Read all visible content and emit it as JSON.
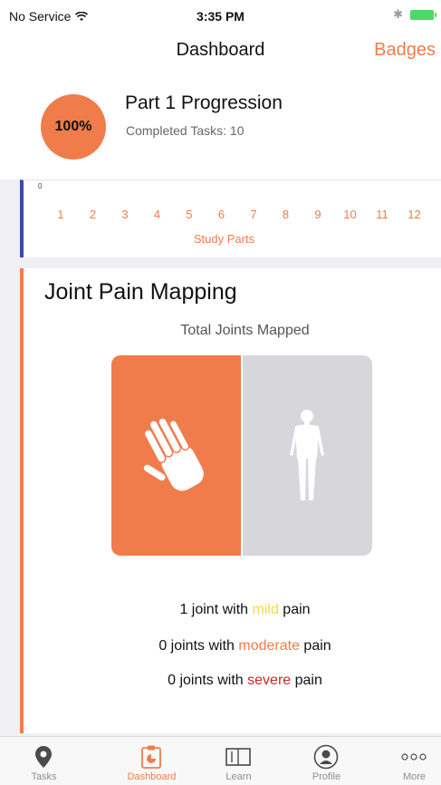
{
  "status_bar": {
    "carrier": "No Service",
    "time": "3:35 PM"
  },
  "nav": {
    "title": "Dashboard",
    "right_button": "Badges"
  },
  "progression": {
    "percent_label": "100%",
    "title": "Part 1 Progression",
    "subtitle": "Completed Tasks: 10"
  },
  "study_parts": {
    "axis_zero": "0",
    "parts": [
      "1",
      "2",
      "3",
      "4",
      "5",
      "6",
      "7",
      "8",
      "9",
      "10",
      "11",
      "12"
    ],
    "caption": "Study Parts"
  },
  "joint_pain": {
    "title": "Joint Pain Mapping",
    "subtitle": "Total Joints Mapped",
    "line1": {
      "prefix": "1 joint with ",
      "level": "mild",
      "suffix": " pain"
    },
    "line2": {
      "prefix": "0 joints with ",
      "level": "moderate",
      "suffix": " pain"
    },
    "line3": {
      "prefix": "0 joints with ",
      "level": "severe",
      "suffix": " pain"
    }
  },
  "tabs": [
    {
      "label": "Tasks",
      "icon": "map-pin-icon"
    },
    {
      "label": "Dashboard",
      "icon": "dashboard-icon"
    },
    {
      "label": "Learn",
      "icon": "book-icon"
    },
    {
      "label": "Profile",
      "icon": "profile-icon"
    },
    {
      "label": "More",
      "icon": "more-icon"
    }
  ],
  "colors": {
    "accent": "#f07c4b",
    "study_bar": "#3b4aa6",
    "mild": "#f4d94a",
    "moderate": "#f07c4b",
    "severe": "#c4262c",
    "panel_gray": "#d7d6db"
  }
}
